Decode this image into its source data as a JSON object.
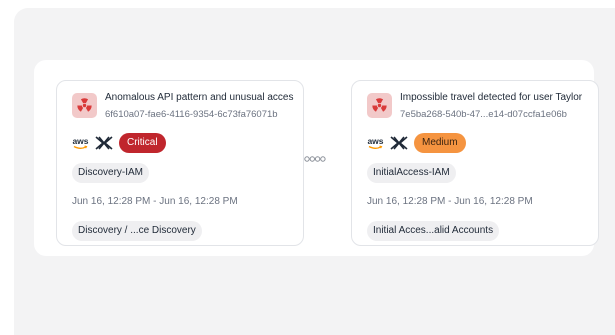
{
  "alerts": [
    {
      "title": "Anomalous API pattern and unusual acces",
      "id": "6f610a07-fae6-4116-9354-6c73fa76071b",
      "severity": "Critical",
      "category": "Discovery-IAM",
      "time_range": "Jun 16, 12:28 PM - Jun 16, 12:28 PM",
      "technique": "Discovery / ...ce Discovery"
    },
    {
      "title": "Impossible travel detected for user Taylor",
      "id": "7e5ba268-540b-47...e14-d07ccfa1e06b",
      "severity": "Medium",
      "category": "InitialAccess-IAM",
      "time_range": "Jun 16, 12:28 PM - Jun 16, 12:28 PM",
      "technique": "Initial Acces...alid Accounts"
    }
  ],
  "provider": {
    "label": "aws"
  },
  "icons": {
    "alert": "radiation-hazard-icon",
    "provider": "aws-logo-icon",
    "integration": "bowtie-icon",
    "link": "chain-link-icon"
  },
  "colors": {
    "critical": "#c0262d",
    "medium": "#f59440",
    "hazard": "#d93a3a"
  }
}
